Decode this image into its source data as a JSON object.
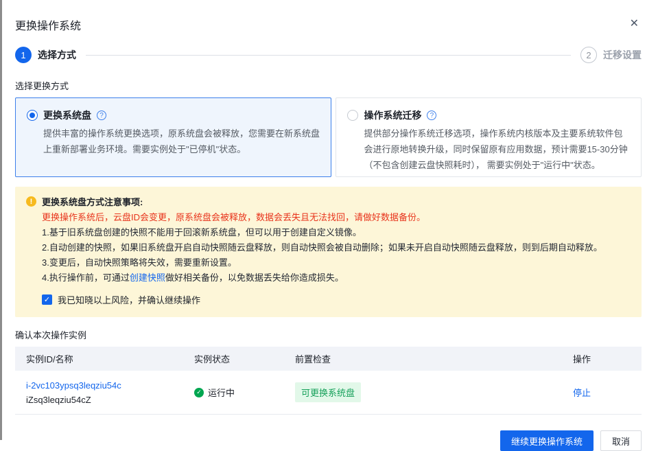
{
  "dialog": {
    "title": "更换操作系统"
  },
  "icons": {
    "close": "✕",
    "help": "?",
    "warning": "!",
    "check": "✓"
  },
  "steps": {
    "step1": {
      "number": "1",
      "label": "选择方式"
    },
    "step2": {
      "number": "2",
      "label": "迁移设置"
    }
  },
  "mode": {
    "section_label": "选择更换方式",
    "options": [
      {
        "title": "更换系统盘",
        "selected": true,
        "description": "提供丰富的操作系统更换选项，原系统盘会被释放，您需要在新系统盘上重新部署业务环境。需要实例处于\"已停机\"状态。"
      },
      {
        "title": "操作系统迁移",
        "selected": false,
        "description": "提供部分操作系统迁移选项，操作系统内核版本及主要系统软件包会进行原地转换升级，同时保留原有应用数据，预计需要15-30分钟（不包含创建云盘快照耗时）， 需要实例处于\"运行中\"状态。"
      }
    ]
  },
  "notice": {
    "title": "更换系统盘方式注意事项:",
    "danger_text": "更换操作系统后，云盘ID会变更，原系统盘会被释放，数据会丢失且无法找回，请做好数据备份。",
    "items": [
      "1.基于旧系统盘创建的快照不能用于回滚新系统盘，但可以用于创建自定义镜像。",
      "2.自动创建的快照，如果旧系统盘开启自动快照随云盘释放，则自动快照会被自动删除；如果未开启自动快照随云盘释放，则到后期自动释放。",
      "3.变更后，自动快照策略将失效，需要重新设置。"
    ],
    "item4": {
      "prefix": "4.执行操作前，可通过",
      "link": "创建快照",
      "suffix": "做好相关备份，以免数据丢失给你造成损失。"
    },
    "checkbox_checked": true,
    "checkbox_label": "我已知晓以上风险，并确认继续操作"
  },
  "table": {
    "section_label": "确认本次操作实例",
    "headers": [
      "实例ID/名称",
      "实例状态",
      "前置检查",
      "操作"
    ],
    "rows": [
      {
        "instance_id": "i-2vc103ypsq3leqziu54c",
        "instance_name": "iZsq3leqziu54cZ",
        "status": "运行中",
        "precheck": "可更换系统盘",
        "action": "停止"
      }
    ]
  },
  "footer": {
    "confirm_label": "继续更换操作系统",
    "cancel_label": "取消"
  },
  "colors": {
    "accent_blue": "#1366ec",
    "selected_card_bg": "#eff5fd",
    "selected_card_border": "#3c7feb",
    "warning_bg": "#fdf6d8",
    "warning_icon": "#f7ba1e",
    "danger_red": "#e8341c",
    "status_green": "#00a650",
    "badge_bg": "#e2f8e9",
    "badge_text": "#16a05a"
  }
}
